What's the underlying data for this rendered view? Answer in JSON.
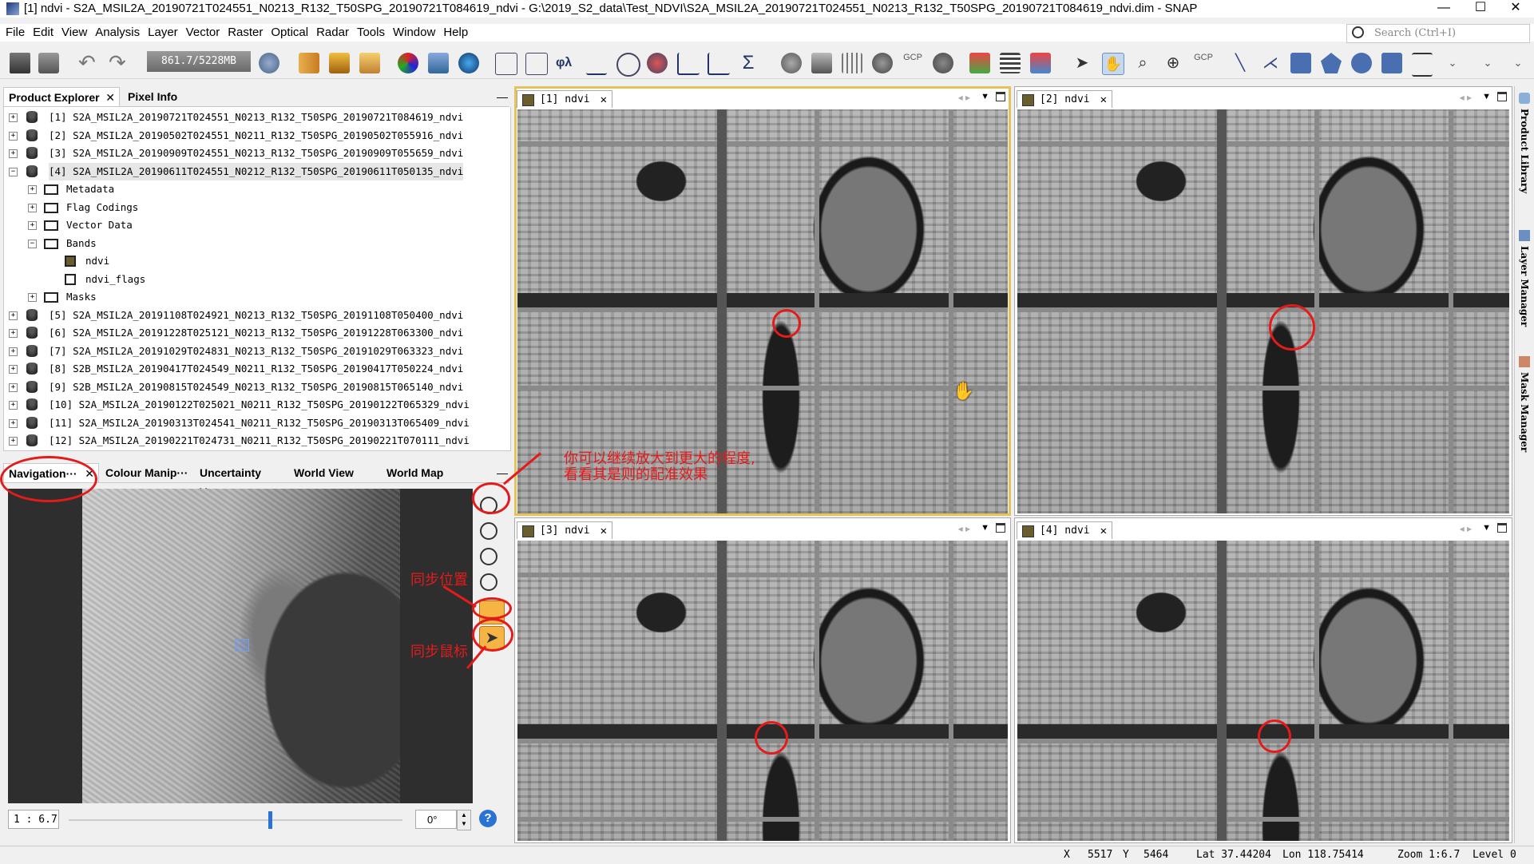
{
  "window": {
    "title": "[1] ndvi - S2A_MSIL2A_20190721T024551_N0213_R132_T50SPG_20190721T084619_ndvi - G:\\2019_S2_data\\Test_NDVI\\S2A_MSIL2A_20190721T024551_N0213_R132_T50SPG_20190721T084619_ndvi.dim - SNAP",
    "minimize": "—",
    "maximize": "☐",
    "close": "✕"
  },
  "menu": [
    "File",
    "Edit",
    "View",
    "Analysis",
    "Layer",
    "Vector",
    "Raster",
    "Optical",
    "Radar",
    "Tools",
    "Window",
    "Help"
  ],
  "search": {
    "placeholder": "Search (Ctrl+I)"
  },
  "toolbar": {
    "memory": "861.7/5228MB",
    "gcp_label_1": "GCP",
    "gcp_label_2": "GCP"
  },
  "product_explorer": {
    "tabs": [
      "Product Explorer",
      "Pixel Info"
    ],
    "products": [
      "[1]  S2A_MSIL2A_20190721T024551_N0213_R132_T50SPG_20190721T084619_ndvi",
      "[2]  S2A_MSIL2A_20190502T024551_N0211_R132_T50SPG_20190502T055916_ndvi",
      "[3]  S2A_MSIL2A_20190909T024551_N0213_R132_T50SPG_20190909T055659_ndvi",
      "[4]  S2A_MSIL2A_20190611T024551_N0212_R132_T50SPG_20190611T050135_ndvi",
      "[5]  S2A_MSIL2A_20191108T024921_N0213_R132_T50SPG_20191108T050400_ndvi",
      "[6]  S2A_MSIL2A_20191228T025121_N0213_R132_T50SPG_20191228T063300_ndvi",
      "[7]  S2A_MSIL2A_20191029T024831_N0213_R132_T50SPG_20191029T063323_ndvi",
      "[8]  S2B_MSIL2A_20190417T024549_N0211_R132_T50SPG_20190417T050224_ndvi",
      "[9]  S2B_MSIL2A_20190815T024549_N0213_R132_T50SPG_20190815T065140_ndvi",
      "[10]  S2A_MSIL2A_20190122T025021_N0211_R132_T50SPG_20190122T065329_ndvi",
      "[11]  S2A_MSIL2A_20190313T024541_N0211_R132_T50SPG_20190313T065409_ndvi",
      "[12]  S2A_MSIL2A_20190221T024731_N0211_R132_T50SPG_20190221T070111_ndvi"
    ],
    "children": [
      "Metadata",
      "Flag Codings",
      "Vector Data",
      "Bands",
      "Masks"
    ],
    "bands": [
      "ndvi",
      "ndvi_flags"
    ]
  },
  "navigation": {
    "tabs": [
      "Navigation···",
      "Colour Manip···",
      "Uncertainty V···",
      "World View",
      "World Map"
    ],
    "scale": "1 : 6.7",
    "rotation": "0°"
  },
  "annotations": {
    "zoom_note_line1": "你可以继续放大到更大的程度,",
    "zoom_note_line2": "看看其是则的配准效果",
    "sync_position": "同步位置",
    "sync_cursor": "同步鼠标"
  },
  "views": [
    {
      "label": "[1]  ndvi"
    },
    {
      "label": "[2]  ndvi"
    },
    {
      "label": "[3]  ndvi"
    },
    {
      "label": "[4]  ndvi"
    }
  ],
  "side_panels": [
    "Product Library",
    "Layer Manager",
    "Mask Manager"
  ],
  "status": {
    "x_label": "X",
    "x": "5517",
    "y_label": "Y",
    "y": "5464",
    "lat": "Lat 37.44204",
    "lon": "Lon 118.75414",
    "zoom": "Zoom 1:6.7",
    "level": "Level 0"
  },
  "colors": {
    "accent_red": "#e41b1b",
    "selection": "#e6c35a"
  }
}
